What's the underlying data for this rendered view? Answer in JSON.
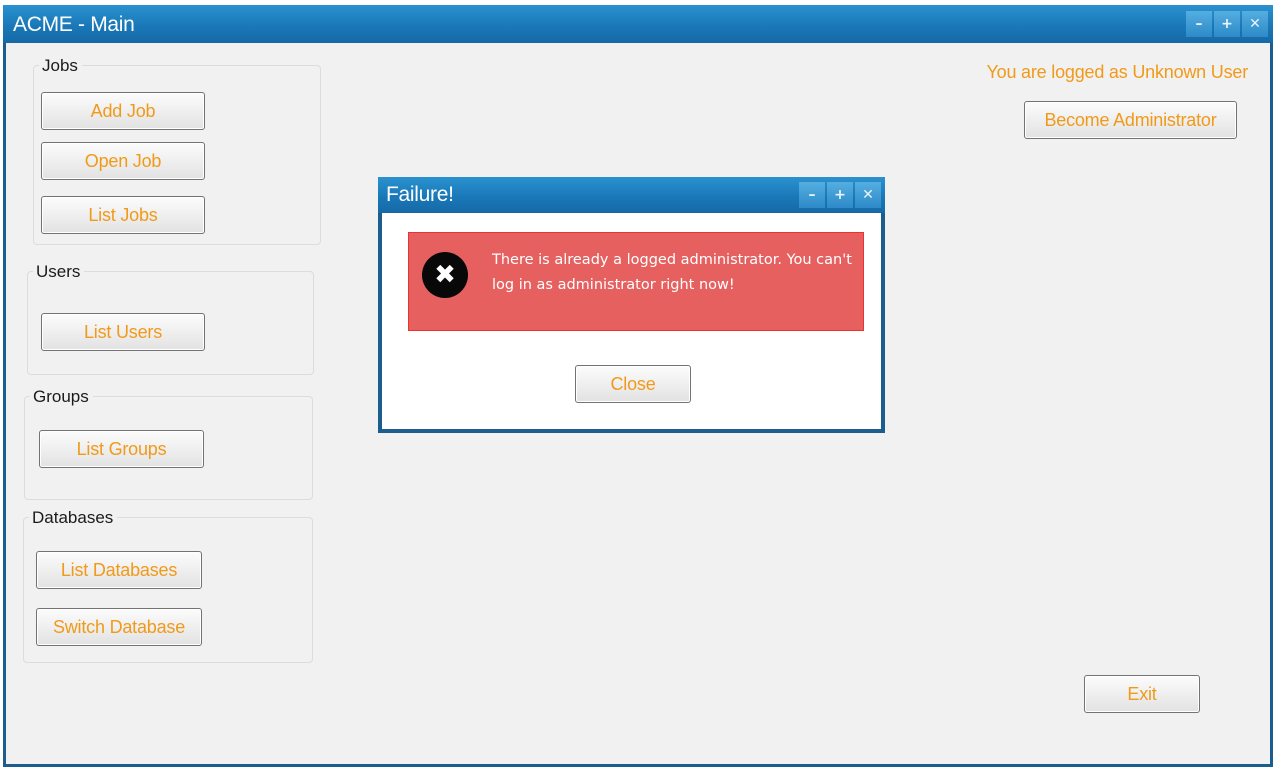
{
  "window": {
    "title": "ACME - Main",
    "controls": {
      "minimize": "–",
      "maximize": "+",
      "close": "✕"
    }
  },
  "jobs": {
    "legend": "Jobs",
    "add_job": "Add Job",
    "open_job": "Open Job",
    "list_jobs": "List Jobs"
  },
  "users": {
    "legend": "Users",
    "list_users": "List Users"
  },
  "groups": {
    "legend": "Groups",
    "list_groups": "List Groups"
  },
  "databases": {
    "legend": "Databases",
    "list_databases": "List Databases",
    "switch_database": "Switch Database"
  },
  "status": {
    "logged_text": "You are logged as Unknown User",
    "become_admin": "Become Administrator"
  },
  "exit_label": "Exit",
  "dialog": {
    "title": "Failure!",
    "controls": {
      "minimize": "–",
      "maximize": "+",
      "close": "✕"
    },
    "icon_glyph": "✖",
    "message": "There is already a logged administrator. You can't log in as administrator right now!",
    "close_label": "Close"
  },
  "colors": {
    "titlebar": "#1a78b8",
    "accent_text": "#f19a1a",
    "alert_bg": "#e66060",
    "window_bg": "#f1f1f1"
  }
}
